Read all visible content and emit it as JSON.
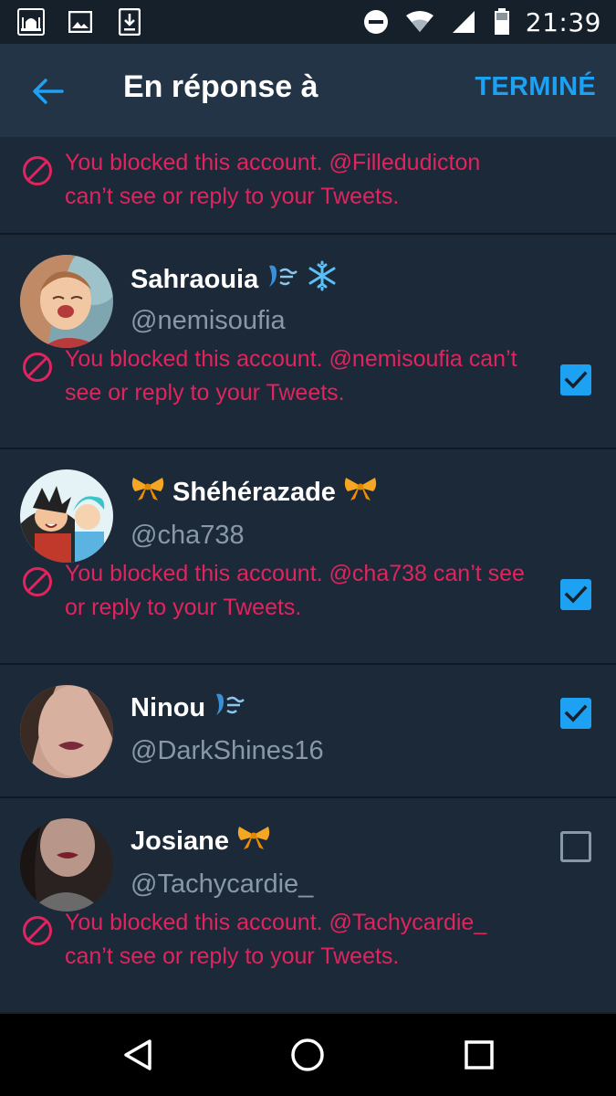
{
  "status_bar": {
    "time": "21:39",
    "icons": [
      "mosque-app-icon",
      "image-icon",
      "download-icon",
      "dnd-icon",
      "wifi-icon",
      "signal-icon",
      "battery-icon"
    ]
  },
  "app_bar": {
    "title": "En réponse à",
    "done_label": "TERMINÉ",
    "accent": "#1da1f2"
  },
  "colors": {
    "background": "#15202b",
    "row_bg": "#1c2938",
    "blocked_text": "#e0245e",
    "secondary_text": "#8899a6"
  },
  "top_notice": {
    "text_line1": "You blocked this account. @Filledudicton",
    "text_line2": "can’t see or reply to your Tweets."
  },
  "users": [
    {
      "name": "Sahraouia",
      "emoji": [
        "wind-face-icon",
        "snowflake-icon"
      ],
      "handle": "@nemisoufia",
      "checked": true,
      "notice_line1": "You blocked this account. @nemisoufia can’t",
      "notice_line2": "see or reply to your Tweets."
    },
    {
      "name": "Shéhérazade",
      "emoji": [
        "ribbon-icon",
        "ribbon-icon"
      ],
      "handle": "@cha738",
      "checked": true,
      "notice_line1": "You blocked this account. @cha738 can’t see",
      "notice_line2": "or reply to your Tweets."
    },
    {
      "name": "Ninou",
      "emoji": [
        "wind-face-icon"
      ],
      "handle": "@DarkShines16",
      "checked": true
    },
    {
      "name": "Josiane",
      "emoji": [
        "ribbon-icon"
      ],
      "handle": "@Tachycardie_",
      "checked": false,
      "notice_line1": "You blocked this account. @Tachycardie_",
      "notice_line2": "can’t see or reply to your Tweets."
    }
  ],
  "nav_bar": {
    "buttons": [
      "back-triangle-icon",
      "home-circle-icon",
      "recents-square-icon"
    ]
  }
}
